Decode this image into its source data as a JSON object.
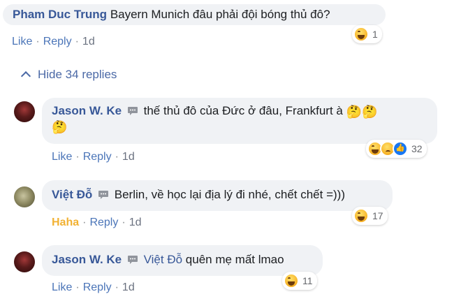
{
  "comments": [
    {
      "author": "Pham Duc Trung",
      "text": "Bayern Munich đâu phải đội bóng thủ đô?",
      "actions": {
        "like": "Like",
        "reply": "Reply",
        "time": "1d"
      },
      "reactions": {
        "icons": [
          "haha-icon"
        ],
        "count": "1"
      }
    },
    {
      "author": "Jason W. Ke",
      "text": "thế thủ đô của Đức ở đâu, Frankfurt à",
      "emojis": [
        "🤔",
        "🤔",
        "🤔"
      ],
      "actions": {
        "like": "Like",
        "reply": "Reply",
        "time": "1d"
      },
      "reactions": {
        "icons": [
          "haha-icon",
          "sad-icon",
          "like-icon"
        ],
        "count": "32"
      }
    },
    {
      "author": "Việt Đỗ",
      "text": "Berlin, về học lại địa lý đi nhé, chết chết =)))",
      "actions": {
        "like": "Haha",
        "reply": "Reply",
        "time": "1d"
      },
      "reactions": {
        "icons": [
          "haha-icon"
        ],
        "count": "17"
      }
    },
    {
      "author": "Jason W. Ke",
      "mention": "Việt Đỗ",
      "text": "quên mẹ mất lmao",
      "actions": {
        "like": "Like",
        "reply": "Reply",
        "time": "1d"
      },
      "reactions": {
        "icons": [
          "haha-icon"
        ],
        "count": "11"
      }
    }
  ],
  "hide_replies": "Hide 34 replies",
  "colors": {
    "author": "#385898",
    "bubble": "#f0f2f5",
    "haha": "#f2b233",
    "link": "#4b75b8"
  }
}
